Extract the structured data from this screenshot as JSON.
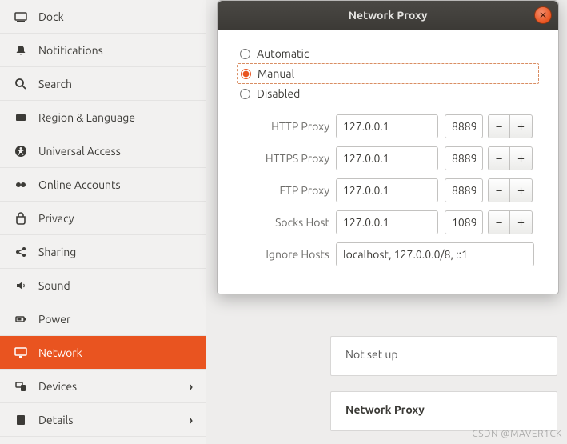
{
  "sidebar": {
    "items": [
      {
        "label": "Dock",
        "icon": "dock",
        "active": false
      },
      {
        "label": "Notifications",
        "icon": "bell",
        "active": false
      },
      {
        "label": "Search",
        "icon": "search",
        "active": false
      },
      {
        "label": "Region & Language",
        "icon": "globe",
        "active": false
      },
      {
        "label": "Universal Access",
        "icon": "access",
        "active": false
      },
      {
        "label": "Online Accounts",
        "icon": "cloud",
        "active": false
      },
      {
        "label": "Privacy",
        "icon": "privacy",
        "active": false
      },
      {
        "label": "Sharing",
        "icon": "share",
        "active": false
      },
      {
        "label": "Sound",
        "icon": "sound",
        "active": false
      },
      {
        "label": "Power",
        "icon": "power",
        "active": false
      },
      {
        "label": "Network",
        "icon": "network",
        "active": true
      },
      {
        "label": "Devices",
        "icon": "devices",
        "active": false,
        "chevron": true
      },
      {
        "label": "Details",
        "icon": "details",
        "active": false,
        "chevron": true
      }
    ]
  },
  "dialog": {
    "title": "Network Proxy",
    "radios": [
      {
        "label": "Automatic",
        "value": "auto",
        "selected": false
      },
      {
        "label": "Manual",
        "value": "manual",
        "selected": true
      },
      {
        "label": "Disabled",
        "value": "disabled",
        "selected": false
      }
    ],
    "fields": {
      "http": {
        "label": "HTTP Proxy",
        "host": "127.0.0.1",
        "port": "8889"
      },
      "https": {
        "label": "HTTPS Proxy",
        "host": "127.0.0.1",
        "port": "8889"
      },
      "ftp": {
        "label": "FTP Proxy",
        "host": "127.0.0.1",
        "port": "8889"
      },
      "socks": {
        "label": "Socks Host",
        "host": "127.0.0.1",
        "port": "1089"
      },
      "ignore": {
        "label": "Ignore Hosts",
        "value": "localhost, 127.0.0.0/8, ::1"
      }
    },
    "minus": "−",
    "plus": "+"
  },
  "bg": {
    "notsetup": "Not set up",
    "proxyhdr": "Network Proxy"
  },
  "watermark": "CSDN @MAVER1CK"
}
